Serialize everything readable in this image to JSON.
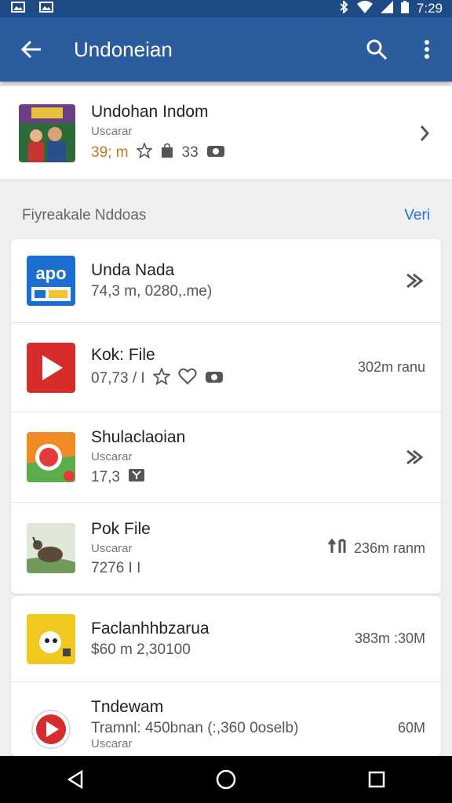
{
  "status_bar": {
    "time": "7:29"
  },
  "app_bar": {
    "title": "Undoneian"
  },
  "featured": {
    "title": "Undohan Indom",
    "subtitle": "Uscarar",
    "meta_orange": "39; m",
    "meta_count": "33"
  },
  "section": {
    "label": "Fiyreakale Nddoas",
    "link": "Veri"
  },
  "list": [
    {
      "title": "Unda Nada",
      "meta": "74,3 m, 0280,.me)",
      "trail": "",
      "icon": "apo-app-icon",
      "color": "#1a6fcf"
    },
    {
      "title": "Kok: File",
      "meta": "07,73 / I",
      "trail": "302m ranu",
      "icon": "video-play-icon",
      "color": "#d62c2c"
    },
    {
      "title": "Shulaclaoian",
      "subtitle": "Uscarar",
      "meta": "17,3",
      "trail": "",
      "icon": "camera-app-icon",
      "color": "#f08a24"
    },
    {
      "title": "Pok File",
      "subtitle": "Uscarar",
      "meta": "7276 I I",
      "trail": "236m ranm",
      "icon": "bird-photo-icon",
      "color": "#7a9a6e"
    }
  ],
  "list2": [
    {
      "title": "Faclanhhbzarua",
      "meta": "$60 m 2,30100",
      "trail": "383m :30M",
      "icon": "yellow-app-icon",
      "color": "#f2c81e"
    },
    {
      "title": "Tndewam",
      "meta": "Tramnl: 450bnan (:,360 0oselb)",
      "subtitle2": "Uscarar",
      "trail": "60M",
      "icon": "play-circle-icon",
      "color": "#d62c2c"
    }
  ]
}
